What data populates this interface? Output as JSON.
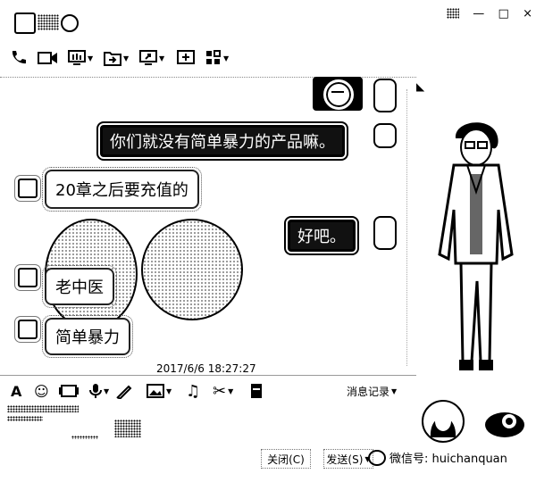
{
  "window": {
    "controls": {
      "minimize": "—",
      "restore": "□",
      "close": "×"
    }
  },
  "toolbar": {
    "icons": [
      "phone-icon",
      "video-icon",
      "screen-share-icon",
      "file-transfer-icon",
      "remote-desktop-icon",
      "add-app-icon",
      "apps-grid-icon"
    ]
  },
  "chat": {
    "messages": [
      {
        "side": "right",
        "type": "sticker"
      },
      {
        "side": "right",
        "type": "text",
        "text": "你们就没有简单暴力的产品嘛。"
      },
      {
        "side": "left",
        "type": "text",
        "text": "20章之后要充值的"
      },
      {
        "side": "right",
        "type": "text",
        "text": "好吧。"
      },
      {
        "side": "left",
        "type": "text",
        "text": "老中医"
      },
      {
        "side": "left",
        "type": "text",
        "text": "简单暴力"
      }
    ],
    "timestamp": "2017/6/6 18:27:27"
  },
  "input_toolbar": {
    "history_label": "消息记录"
  },
  "footer": {
    "close_label": "关闭(C)",
    "send_label": "发送(S)",
    "watermark": "微信号: huichanquan"
  }
}
